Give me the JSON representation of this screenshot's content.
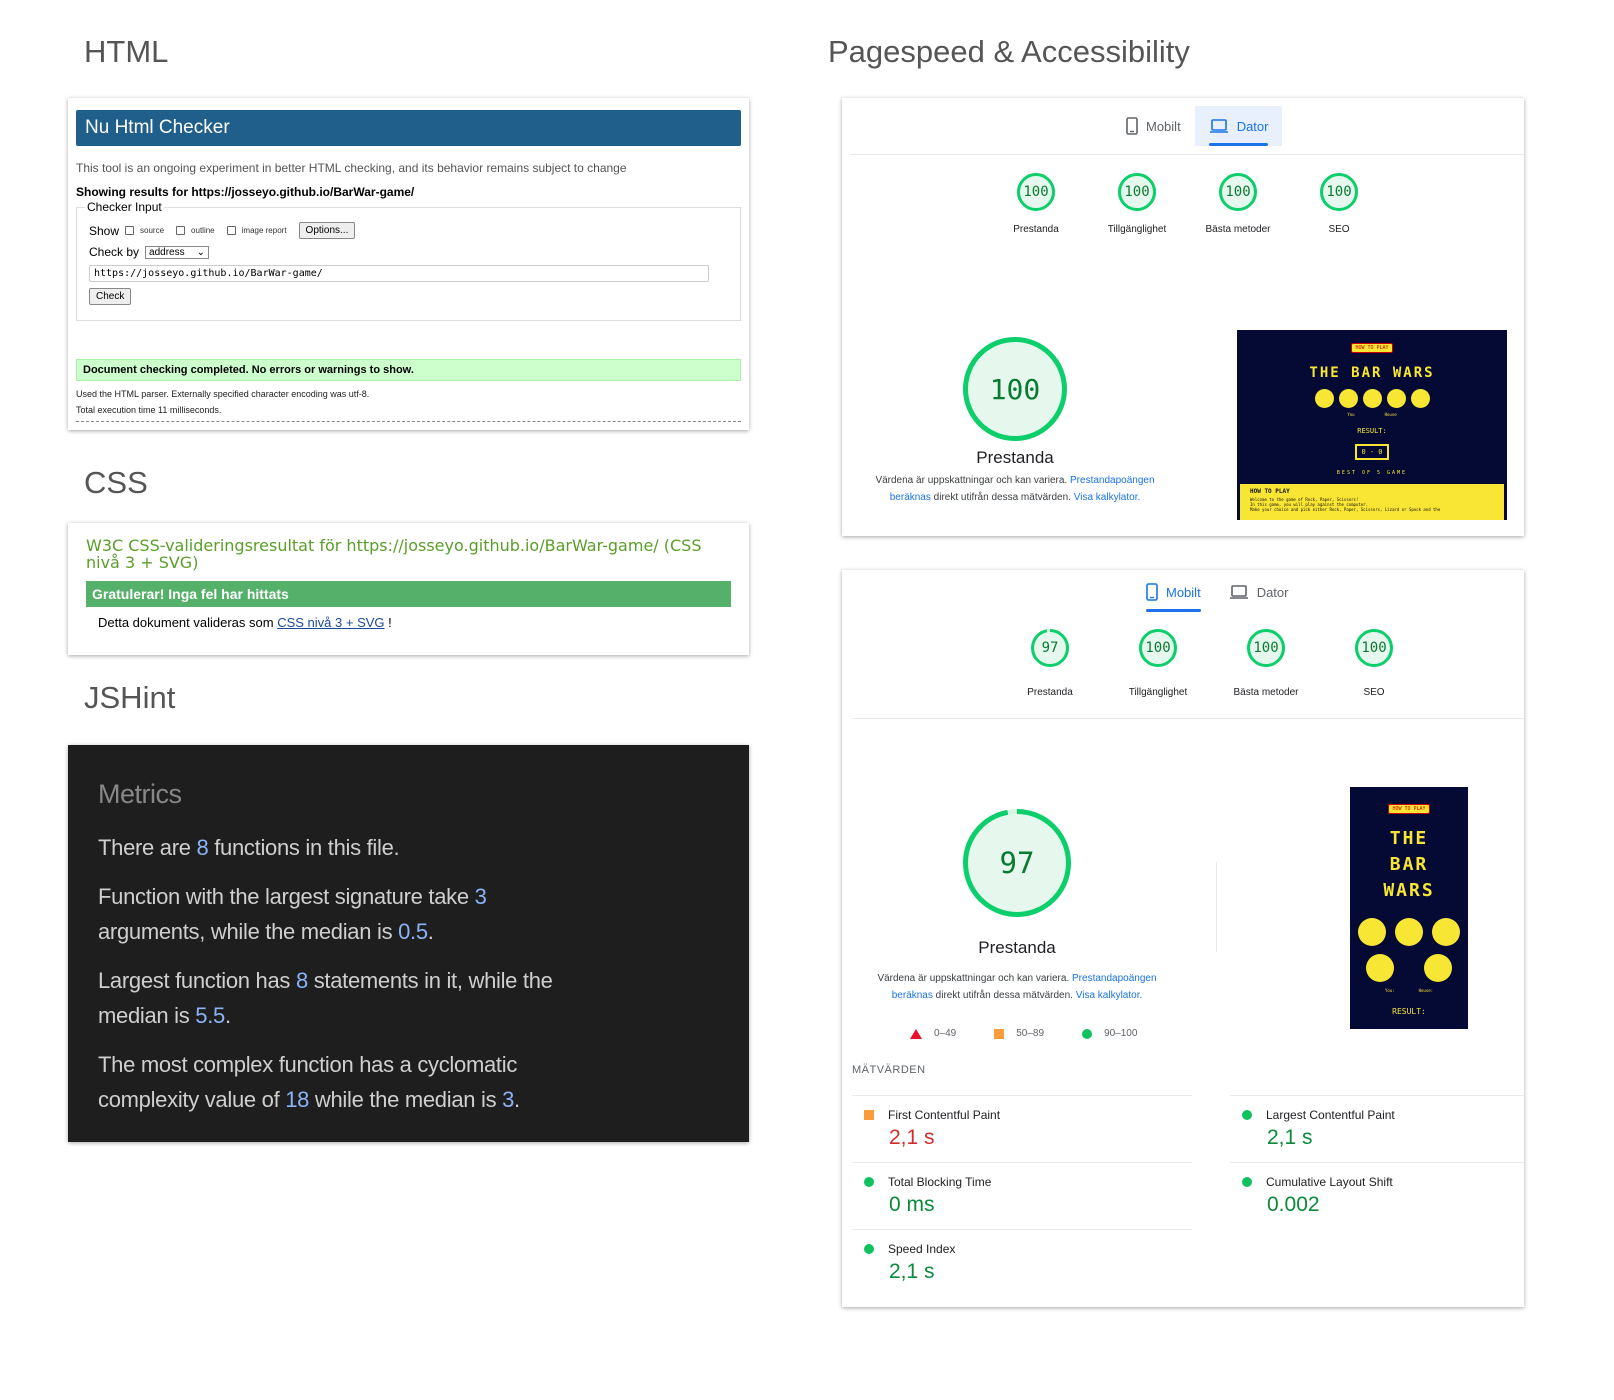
{
  "sections": {
    "html": "HTML",
    "css": "CSS",
    "jshint": "JSHint",
    "pagespeed": "Pagespeed & Accessibility"
  },
  "nu": {
    "header": "Nu Html Checker",
    "intro": "This tool is an ongoing experiment in better HTML checking, and its behavior remains subject to change",
    "showing": "Showing results for https://josseyo.github.io/BarWar-game/",
    "legend": "Checker Input",
    "show_label": "Show",
    "opt_source": "source",
    "opt_outline": "outline",
    "opt_image_report": "image report",
    "options_button": "Options...",
    "check_by_label": "Check by",
    "check_by_value": "address",
    "url_value": "https://josseyo.github.io/BarWar-game/",
    "check_button": "Check",
    "success": "Document checking completed. No errors or warnings to show.",
    "note1": "Used the HTML parser. Externally specified character encoding was utf-8.",
    "note2": "Total execution time 11 milliseconds."
  },
  "w3c": {
    "title": "W3C CSS-valideringsresultat för https://josseyo.github.io/BarWar-game/ (CSS nivå 3 + SVG)",
    "congrats": "Gratulerar! Inga fel har hittats",
    "text_before": "Detta dokument valideras som",
    "link": "CSS nivå 3 + SVG",
    "text_after": "!"
  },
  "jshint": {
    "heading": "Metrics",
    "p1_a": "There are",
    "p1_n": "8",
    "p1_b": "functions in this file.",
    "p2_a": "Function with the largest signature take",
    "p2_n": "3",
    "p2_b": "arguments, while the median is",
    "p2_n2": "0.5",
    "p2_c": ".",
    "p3_a": "Largest function has",
    "p3_n": "8",
    "p3_b": "statements in it, while the median is",
    "p3_n2": "5.5",
    "p3_c": ".",
    "p4_a": "The most complex function has a cyclomatic complexity value of",
    "p4_n": "18",
    "p4_b": "while the median is",
    "p4_n2": "3",
    "p4_c": "."
  },
  "lh_desktop": {
    "tab_mobile": "Mobilt",
    "tab_desktop": "Dator",
    "scores": [
      {
        "value": "100",
        "label": "Prestanda"
      },
      {
        "value": "100",
        "label": "Tillgänglighet"
      },
      {
        "value": "100",
        "label": "Bästa metoder"
      },
      {
        "value": "100",
        "label": "SEO"
      }
    ],
    "big_score": "100",
    "big_label": "Prestanda",
    "note_a": "Värdena är uppskattningar och kan variera.",
    "note_link1": "Prestandapoängen beräknas",
    "note_b": "direkt utifrån dessa mätvärden.",
    "note_link2": "Visa kalkylator.",
    "shot": {
      "how": "HOW TO PLAY",
      "title": "THE BAR WARS",
      "you": "You",
      "house": "House",
      "result": "RESULT:",
      "score": "0 - 0",
      "best_of": "BEST OF 5 GAME",
      "how_panel": "HOW TO PLAY",
      "how_text1": "Welcome to the game of Rock, Paper, Scissors!",
      "how_text2": "In this game, you will play against the computer.",
      "how_text3": "Make your choice and pick either Rock, Paper, Scissors, Lizard or Spock and the"
    }
  },
  "lh_mobile": {
    "tab_mobile": "Mobilt",
    "tab_desktop": "Dator",
    "scores": [
      {
        "value": "97",
        "label": "Prestanda"
      },
      {
        "value": "100",
        "label": "Tillgänglighet"
      },
      {
        "value": "100",
        "label": "Bästa metoder"
      },
      {
        "value": "100",
        "label": "SEO"
      }
    ],
    "big_score": "97",
    "big_label": "Prestanda",
    "note_a": "Värdena är uppskattningar och kan variera.",
    "note_link1": "Prestandapoängen beräknas",
    "note_b": "direkt utifrån dessa mätvärden.",
    "note_link2": "Visa kalkylator.",
    "legend": [
      "0–49",
      "50–89",
      "90–100"
    ],
    "metrics_heading": "MÄTVÄRDEN",
    "metrics": [
      {
        "label": "First Contentful Paint",
        "value": "2,1 s",
        "status": "orange"
      },
      {
        "label": "Largest Contentful Paint",
        "value": "2,1 s",
        "status": "green"
      },
      {
        "label": "Total Blocking Time",
        "value": "0 ms",
        "status": "green"
      },
      {
        "label": "Cumulative Layout Shift",
        "value": "0.002",
        "status": "green"
      },
      {
        "label": "Speed Index",
        "value": "2,1 s",
        "status": "green"
      }
    ],
    "shot": {
      "how": "HOW TO PLAY",
      "title_1": "THE",
      "title_2": "BAR",
      "title_3": "WARS",
      "you": "You:",
      "house": "House:",
      "result": "RESULT:"
    }
  },
  "colors": {
    "pass": "#0cce6b",
    "average": "#ffa400",
    "fail": "#ff4e42",
    "nu_blue": "#205f8c",
    "w3c_green": "#55b06a"
  }
}
